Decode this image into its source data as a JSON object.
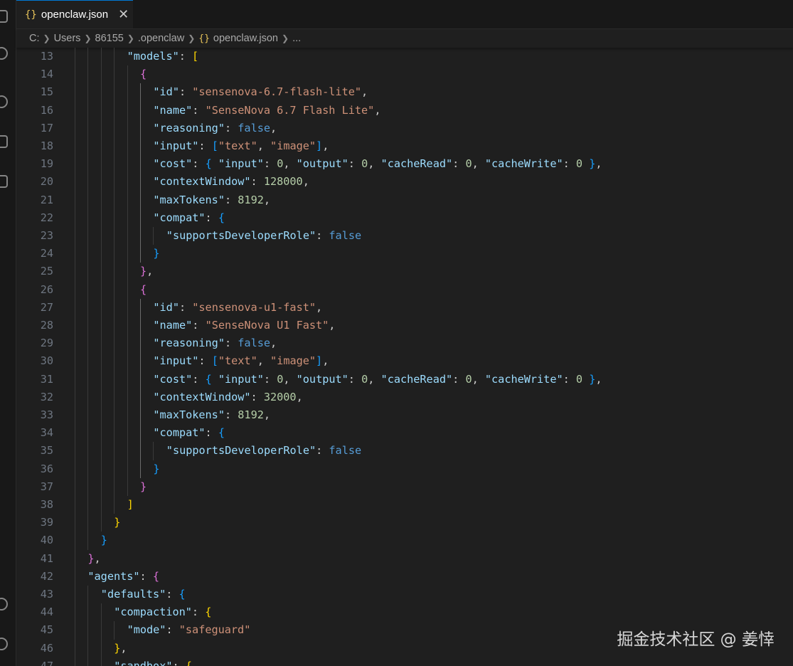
{
  "tab": {
    "icon": "json-braces-icon",
    "braces": "{}",
    "filename": "openclaw.json",
    "close": "✕"
  },
  "breadcrumb": [
    "C:",
    "Users",
    "86155",
    ".openclaw",
    "openclaw.json",
    "..."
  ],
  "breadcrumb_file_icon": "{}",
  "activity_bar_icons": [
    "explorer-icon",
    "search-icon",
    "source-control-icon",
    "run-debug-icon",
    "extensions-icon",
    "account-icon",
    "settings-icon"
  ],
  "colors": {
    "key": "#9cdcfe",
    "string": "#ce9178",
    "number": "#b5cea8",
    "boolean": "#569cd6",
    "bracket_level1": "#ffd700",
    "bracket_level2": "#da70d6",
    "bracket_level3": "#179fff",
    "line_number": "#6e7681",
    "background": "#1f1f1f"
  },
  "code_lines": [
    {
      "n": "13",
      "indent": 4,
      "tokens": [
        [
          "k",
          "\"models\""
        ],
        [
          "p",
          ": "
        ],
        [
          "br1",
          "["
        ]
      ]
    },
    {
      "n": "14",
      "indent": 5,
      "tokens": [
        [
          "br2",
          "{"
        ]
      ]
    },
    {
      "n": "15",
      "indent": 6,
      "tokens": [
        [
          "k",
          "\"id\""
        ],
        [
          "p",
          ": "
        ],
        [
          "s",
          "\"sensenova-6.7-flash-lite\""
        ],
        [
          "p",
          ","
        ]
      ]
    },
    {
      "n": "16",
      "indent": 6,
      "tokens": [
        [
          "k",
          "\"name\""
        ],
        [
          "p",
          ": "
        ],
        [
          "s",
          "\"SenseNova 6.7 Flash Lite\""
        ],
        [
          "p",
          ","
        ]
      ]
    },
    {
      "n": "17",
      "indent": 6,
      "tokens": [
        [
          "k",
          "\"reasoning\""
        ],
        [
          "p",
          ": "
        ],
        [
          "b",
          "false"
        ],
        [
          "p",
          ","
        ]
      ]
    },
    {
      "n": "18",
      "indent": 6,
      "tokens": [
        [
          "k",
          "\"input\""
        ],
        [
          "p",
          ": "
        ],
        [
          "br3",
          "["
        ],
        [
          "s",
          "\"text\""
        ],
        [
          "p",
          ", "
        ],
        [
          "s",
          "\"image\""
        ],
        [
          "br3",
          "]"
        ],
        [
          "p",
          ","
        ]
      ]
    },
    {
      "n": "19",
      "indent": 6,
      "tokens": [
        [
          "k",
          "\"cost\""
        ],
        [
          "p",
          ": "
        ],
        [
          "br3",
          "{"
        ],
        [
          "p",
          " "
        ],
        [
          "k",
          "\"input\""
        ],
        [
          "p",
          ": "
        ],
        [
          "n",
          "0"
        ],
        [
          "p",
          ", "
        ],
        [
          "k",
          "\"output\""
        ],
        [
          "p",
          ": "
        ],
        [
          "n",
          "0"
        ],
        [
          "p",
          ", "
        ],
        [
          "k",
          "\"cacheRead\""
        ],
        [
          "p",
          ": "
        ],
        [
          "n",
          "0"
        ],
        [
          "p",
          ", "
        ],
        [
          "k",
          "\"cacheWrite\""
        ],
        [
          "p",
          ": "
        ],
        [
          "n",
          "0"
        ],
        [
          "p",
          " "
        ],
        [
          "br3",
          "}"
        ],
        [
          "p",
          ","
        ]
      ]
    },
    {
      "n": "20",
      "indent": 6,
      "tokens": [
        [
          "k",
          "\"contextWindow\""
        ],
        [
          "p",
          ": "
        ],
        [
          "n",
          "128000"
        ],
        [
          "p",
          ","
        ]
      ]
    },
    {
      "n": "21",
      "indent": 6,
      "tokens": [
        [
          "k",
          "\"maxTokens\""
        ],
        [
          "p",
          ": "
        ],
        [
          "n",
          "8192"
        ],
        [
          "p",
          ","
        ]
      ]
    },
    {
      "n": "22",
      "indent": 6,
      "tokens": [
        [
          "k",
          "\"compat\""
        ],
        [
          "p",
          ": "
        ],
        [
          "br3",
          "{"
        ]
      ]
    },
    {
      "n": "23",
      "indent": 7,
      "tokens": [
        [
          "k",
          "\"supportsDeveloperRole\""
        ],
        [
          "p",
          ": "
        ],
        [
          "b",
          "false"
        ]
      ]
    },
    {
      "n": "24",
      "indent": 6,
      "tokens": [
        [
          "br3",
          "}"
        ]
      ]
    },
    {
      "n": "25",
      "indent": 5,
      "tokens": [
        [
          "br2",
          "}"
        ],
        [
          "p",
          ","
        ]
      ]
    },
    {
      "n": "26",
      "indent": 5,
      "tokens": [
        [
          "br2",
          "{"
        ]
      ]
    },
    {
      "n": "27",
      "indent": 6,
      "tokens": [
        [
          "k",
          "\"id\""
        ],
        [
          "p",
          ": "
        ],
        [
          "s",
          "\"sensenova-u1-fast\""
        ],
        [
          "p",
          ","
        ]
      ]
    },
    {
      "n": "28",
      "indent": 6,
      "tokens": [
        [
          "k",
          "\"name\""
        ],
        [
          "p",
          ": "
        ],
        [
          "s",
          "\"SenseNova U1 Fast\""
        ],
        [
          "p",
          ","
        ]
      ]
    },
    {
      "n": "29",
      "indent": 6,
      "tokens": [
        [
          "k",
          "\"reasoning\""
        ],
        [
          "p",
          ": "
        ],
        [
          "b",
          "false"
        ],
        [
          "p",
          ","
        ]
      ]
    },
    {
      "n": "30",
      "indent": 6,
      "tokens": [
        [
          "k",
          "\"input\""
        ],
        [
          "p",
          ": "
        ],
        [
          "br3",
          "["
        ],
        [
          "s",
          "\"text\""
        ],
        [
          "p",
          ", "
        ],
        [
          "s",
          "\"image\""
        ],
        [
          "br3",
          "]"
        ],
        [
          "p",
          ","
        ]
      ]
    },
    {
      "n": "31",
      "indent": 6,
      "tokens": [
        [
          "k",
          "\"cost\""
        ],
        [
          "p",
          ": "
        ],
        [
          "br3",
          "{"
        ],
        [
          "p",
          " "
        ],
        [
          "k",
          "\"input\""
        ],
        [
          "p",
          ": "
        ],
        [
          "n",
          "0"
        ],
        [
          "p",
          ", "
        ],
        [
          "k",
          "\"output\""
        ],
        [
          "p",
          ": "
        ],
        [
          "n",
          "0"
        ],
        [
          "p",
          ", "
        ],
        [
          "k",
          "\"cacheRead\""
        ],
        [
          "p",
          ": "
        ],
        [
          "n",
          "0"
        ],
        [
          "p",
          ", "
        ],
        [
          "k",
          "\"cacheWrite\""
        ],
        [
          "p",
          ": "
        ],
        [
          "n",
          "0"
        ],
        [
          "p",
          " "
        ],
        [
          "br3",
          "}"
        ],
        [
          "p",
          ","
        ]
      ]
    },
    {
      "n": "32",
      "indent": 6,
      "tokens": [
        [
          "k",
          "\"contextWindow\""
        ],
        [
          "p",
          ": "
        ],
        [
          "n",
          "32000"
        ],
        [
          "p",
          ","
        ]
      ]
    },
    {
      "n": "33",
      "indent": 6,
      "tokens": [
        [
          "k",
          "\"maxTokens\""
        ],
        [
          "p",
          ": "
        ],
        [
          "n",
          "8192"
        ],
        [
          "p",
          ","
        ]
      ]
    },
    {
      "n": "34",
      "indent": 6,
      "tokens": [
        [
          "k",
          "\"compat\""
        ],
        [
          "p",
          ": "
        ],
        [
          "br3",
          "{"
        ]
      ]
    },
    {
      "n": "35",
      "indent": 7,
      "tokens": [
        [
          "k",
          "\"supportsDeveloperRole\""
        ],
        [
          "p",
          ": "
        ],
        [
          "b",
          "false"
        ]
      ]
    },
    {
      "n": "36",
      "indent": 6,
      "tokens": [
        [
          "br3",
          "}"
        ]
      ]
    },
    {
      "n": "37",
      "indent": 5,
      "tokens": [
        [
          "br2",
          "}"
        ]
      ]
    },
    {
      "n": "38",
      "indent": 4,
      "tokens": [
        [
          "br1",
          "]"
        ]
      ]
    },
    {
      "n": "39",
      "indent": 3,
      "tokens": [
        [
          "br1",
          "}"
        ]
      ]
    },
    {
      "n": "40",
      "indent": 2,
      "tokens": [
        [
          "br3",
          "}"
        ]
      ]
    },
    {
      "n": "41",
      "indent": 1,
      "tokens": [
        [
          "br2",
          "}"
        ],
        [
          "p",
          ","
        ]
      ]
    },
    {
      "n": "42",
      "indent": 1,
      "tokens": [
        [
          "k",
          "\"agents\""
        ],
        [
          "p",
          ": "
        ],
        [
          "br2",
          "{"
        ]
      ]
    },
    {
      "n": "43",
      "indent": 2,
      "tokens": [
        [
          "k",
          "\"defaults\""
        ],
        [
          "p",
          ": "
        ],
        [
          "br3",
          "{"
        ]
      ]
    },
    {
      "n": "44",
      "indent": 3,
      "tokens": [
        [
          "k",
          "\"compaction\""
        ],
        [
          "p",
          ": "
        ],
        [
          "br1",
          "{"
        ]
      ]
    },
    {
      "n": "45",
      "indent": 4,
      "tokens": [
        [
          "k",
          "\"mode\""
        ],
        [
          "p",
          ": "
        ],
        [
          "s",
          "\"safeguard\""
        ]
      ]
    },
    {
      "n": "46",
      "indent": 3,
      "tokens": [
        [
          "br1",
          "}"
        ],
        [
          "p",
          ","
        ]
      ]
    },
    {
      "n": "47",
      "indent": 3,
      "tokens": [
        [
          "k",
          "\"sandbox\""
        ],
        [
          "p",
          ": "
        ],
        [
          "br1",
          "{"
        ]
      ]
    }
  ],
  "watermark": "掘金技术社区 @ 姜悻"
}
